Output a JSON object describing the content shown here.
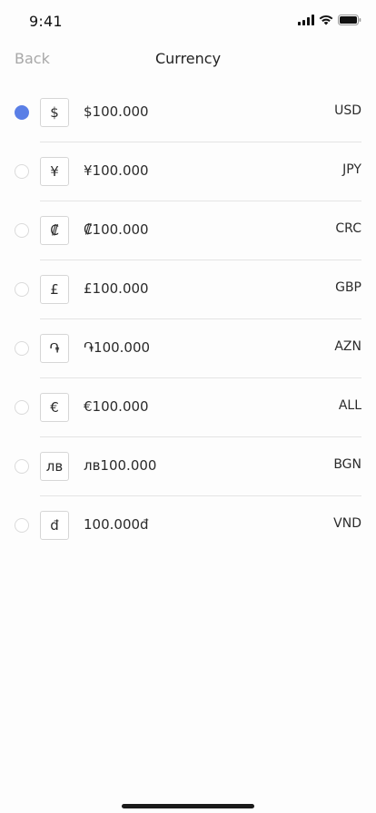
{
  "status_bar": {
    "time": "9:41",
    "icons": [
      "signal-icon",
      "wifi-icon",
      "battery-icon"
    ]
  },
  "nav": {
    "back_label": "Back",
    "title": "Currency"
  },
  "colors": {
    "accent": "#5a7fe6",
    "muted": "#a8a8a8",
    "divider": "#e4e4e4"
  },
  "currencies": [
    {
      "symbol": "$",
      "amount": "$100.000",
      "code": "USD",
      "selected": true
    },
    {
      "symbol": "¥",
      "amount": "¥100.000",
      "code": "JPY",
      "selected": false
    },
    {
      "symbol": "₡",
      "amount": "₡100.000",
      "code": "CRC",
      "selected": false
    },
    {
      "symbol": "£",
      "amount": "£100.000",
      "code": "GBP",
      "selected": false
    },
    {
      "symbol": "֏",
      "amount": "֏100.000",
      "code": "AZN",
      "selected": false
    },
    {
      "symbol": "€",
      "amount": "€100.000",
      "code": "ALL",
      "selected": false
    },
    {
      "symbol": "лв",
      "amount": "лв100.000",
      "code": "BGN",
      "selected": false
    },
    {
      "symbol": "đ",
      "amount": "100.000đ",
      "code": "VND",
      "selected": false
    }
  ]
}
